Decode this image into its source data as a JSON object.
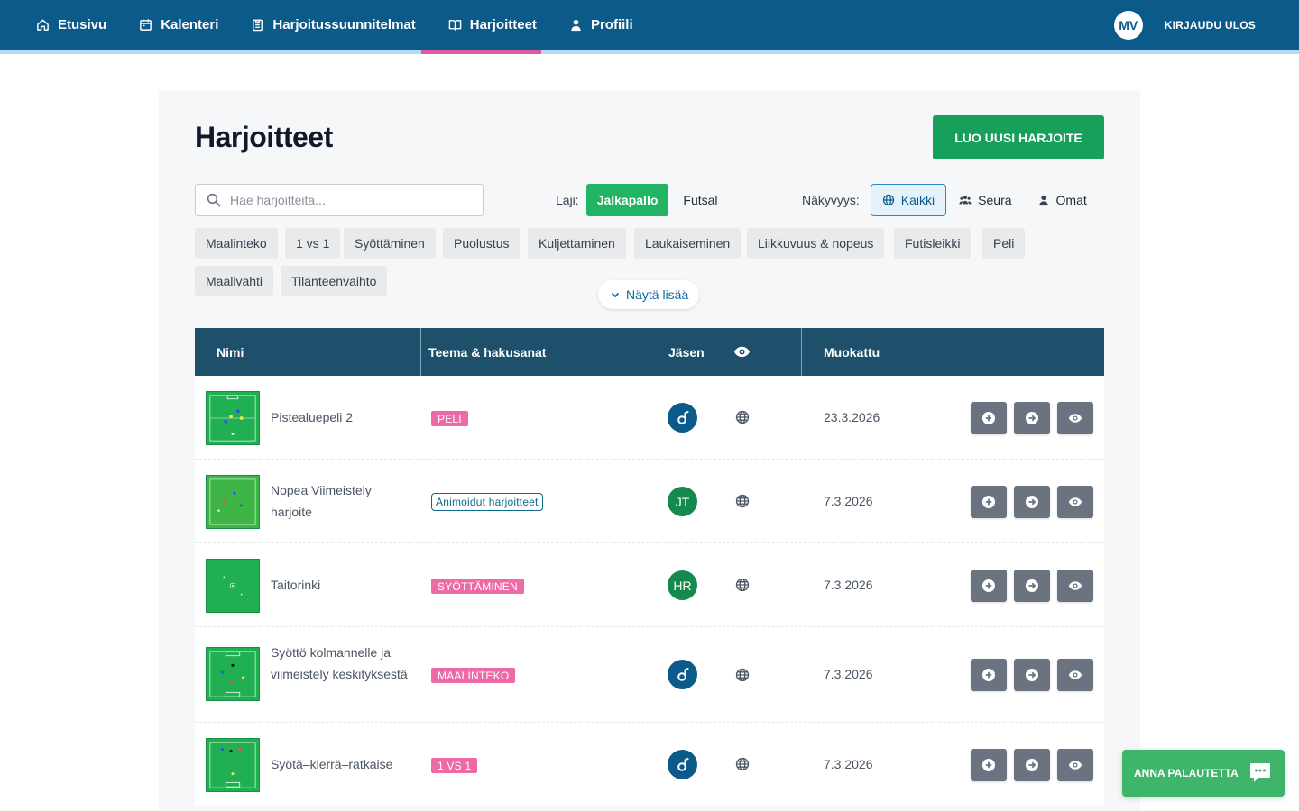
{
  "nav": {
    "items": [
      {
        "label": "Etusivu",
        "icon": "home-icon"
      },
      {
        "label": "Kalenteri",
        "icon": "calendar-icon"
      },
      {
        "label": "Harjoitussuunnitelmat",
        "icon": "clipboard-icon"
      },
      {
        "label": "Harjoitteet",
        "icon": "book-icon",
        "active": true
      },
      {
        "label": "Profiili",
        "icon": "user-icon"
      }
    ],
    "avatar_initials": "MV",
    "logout_label": "KIRJAUDU ULOS"
  },
  "page": {
    "title": "Harjoitteet",
    "create_label": "LUO UUSI HARJOITE"
  },
  "filters": {
    "search_placeholder": "Hae harjoitteita...",
    "sport_label": "Laji:",
    "sports": [
      "Jalkapallo",
      "Futsal"
    ],
    "sport_selected": "Jalkapallo",
    "visibility_label": "Näkyvyys:",
    "visibility_options": [
      "Kaikki",
      "Seura",
      "Omat"
    ],
    "visibility_selected": "Kaikki",
    "tags": [
      "Maalinteko",
      "1 vs 1",
      "Syöttäminen",
      "Puolustus",
      "Kuljettaminen",
      "Laukaiseminen",
      "Liikkuvuus & nopeus",
      "Futisleikki",
      "Peli",
      "Maalivahti",
      "Tilanteenvaihto"
    ],
    "show_more_label": "Näytä lisää"
  },
  "table": {
    "headers": {
      "name": "Nimi",
      "theme": "Teema & hakusanat",
      "member": "Jäsen",
      "modified": "Muokattu"
    },
    "rows": [
      {
        "name": "Pistealuepeli 2",
        "tag": "PELI",
        "tag_style": "pink",
        "member": "",
        "member_style": "blue-logo",
        "modified": "23.3.2026"
      },
      {
        "name": "Nopea Viimeistely harjoite",
        "tag": "Animoidut harjoitteet",
        "tag_style": "outline",
        "member": "JT",
        "member_style": "green",
        "modified": "7.3.2026"
      },
      {
        "name": "Taitorinki",
        "tag": "SYÖTTÄMINEN",
        "tag_style": "pink",
        "member": "HR",
        "member_style": "green",
        "modified": "7.3.2026"
      },
      {
        "name": "Syöttö kolmannelle ja viimeistely keskityksestä",
        "tag": "MAALINTEKO",
        "tag_style": "pink",
        "member": "",
        "member_style": "blue-logo",
        "modified": "7.3.2026"
      },
      {
        "name": "Syötä–kierrä–ratkaise",
        "tag": "1 VS 1",
        "tag_style": "pink",
        "member": "",
        "member_style": "blue-logo",
        "modified": "7.3.2026"
      }
    ]
  },
  "feedback_label": "ANNA PALAUTETTA",
  "colors": {
    "nav": "#0b5a8a",
    "primary_green": "#17a05a",
    "tag_pink": "#ee6aa7",
    "table_header": "#1e4f6b",
    "action_button": "#6b7380"
  }
}
